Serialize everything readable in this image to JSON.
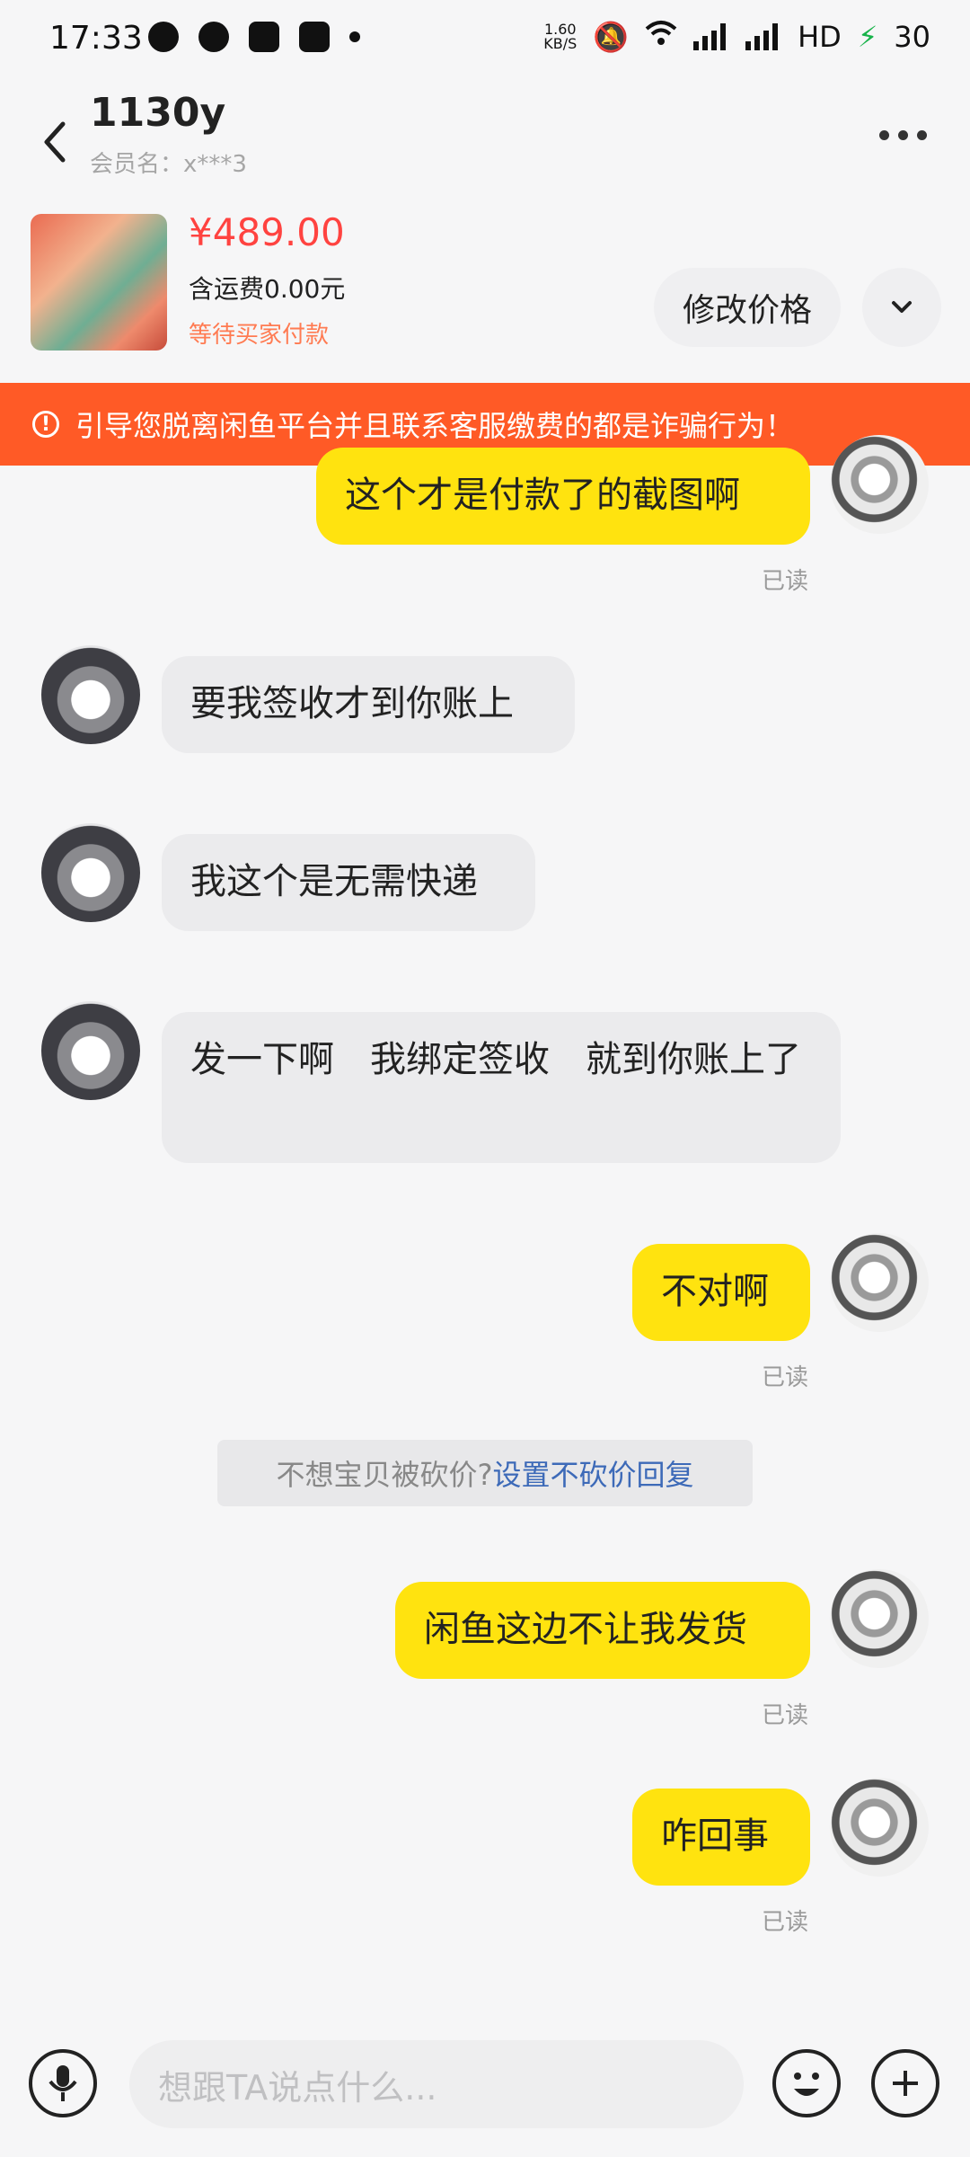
{
  "status_bar": {
    "time": "17:33",
    "speed": "1.60",
    "speed_unit": "KB/S",
    "hd": "HD",
    "battery": "30",
    "app_icons": [
      "wechat-icon",
      "qq-icon",
      "gallery-icon",
      "tieba-icon"
    ]
  },
  "header": {
    "title": "1130y",
    "member_label": "会员名：",
    "member_name": "x***3"
  },
  "product": {
    "price": "¥489.00",
    "shipping": "含运费0.00元",
    "status": "等待买家付款",
    "modify_price_label": "修改价格"
  },
  "warning": {
    "text": "引导您脱离闲鱼平台并且联系客服缴费的都是诈骗行为！"
  },
  "messages": [
    {
      "side": "me",
      "text": "这个才是付款了的截图啊",
      "read": "已读"
    },
    {
      "side": "them",
      "text": "要我签收才到你账上"
    },
    {
      "side": "them",
      "text": "我这个是无需快递"
    },
    {
      "side": "them",
      "text": "发一下啊　我绑定签收　就到你账上了"
    },
    {
      "side": "me",
      "text": "不对啊",
      "read": "已读"
    },
    {
      "side": "me",
      "text": "闲鱼这边不让我发货",
      "read": "已读"
    },
    {
      "side": "me",
      "text": "咋回事",
      "read": "已读"
    }
  ],
  "notice": {
    "text": "不想宝贝被砍价? ",
    "link": "设置不砍价回复"
  },
  "input": {
    "placeholder": "想跟TA说点什么..."
  },
  "colors": {
    "accent_yellow": "#ffe30f",
    "warning_orange": "#ff5a26",
    "price_red": "#ff4340"
  }
}
